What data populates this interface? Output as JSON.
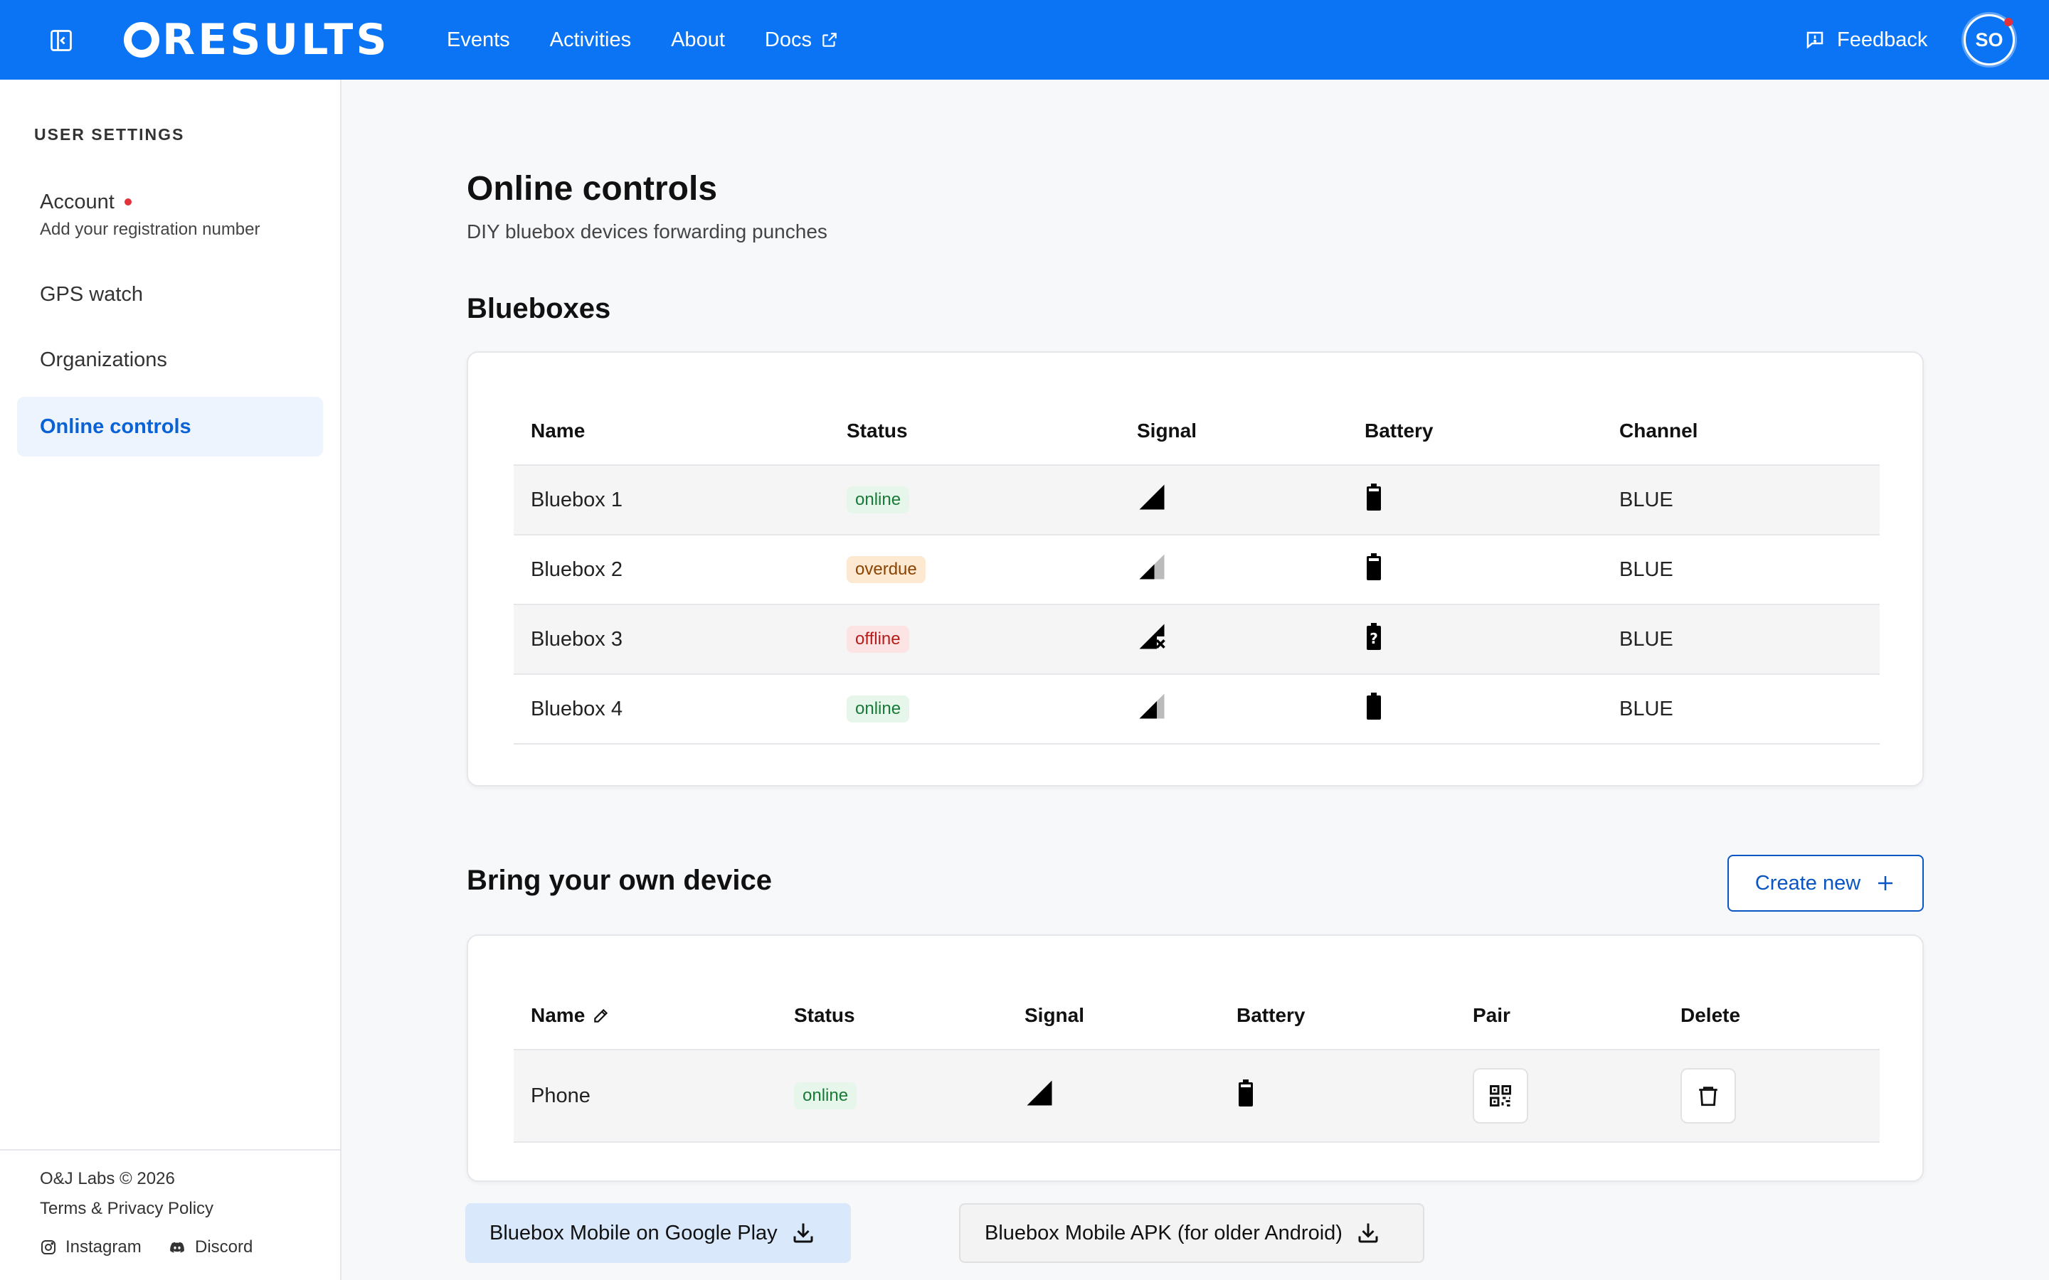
{
  "header": {
    "logo": "RESULTS",
    "nav": [
      "Events",
      "Activities",
      "About",
      "Docs"
    ],
    "feedback": "Feedback",
    "avatar": "SO"
  },
  "sidebar": {
    "heading": "USER SETTINGS",
    "items": [
      {
        "label": "Account",
        "sub": "Add your registration number"
      },
      {
        "label": "GPS watch"
      },
      {
        "label": "Organizations"
      },
      {
        "label": "Online controls"
      }
    ],
    "footer": {
      "copyright": "O&J Labs © 2026",
      "terms": "Terms & Privacy Policy",
      "instagram": "Instagram",
      "discord": "Discord"
    }
  },
  "main": {
    "title": "Online controls",
    "subtitle": "DIY bluebox devices forwarding punches",
    "blueboxes": {
      "title": "Blueboxes",
      "columns": [
        "Name",
        "Status",
        "Signal",
        "Battery",
        "Channel"
      ],
      "rows": [
        {
          "name": "Bluebox 1",
          "status": "online",
          "signal": "signal-full-icon",
          "battery": "battery-high-icon",
          "channel": "BLUE"
        },
        {
          "name": "Bluebox 2",
          "status": "overdue",
          "signal": "signal-medium-icon",
          "battery": "battery-high-icon",
          "channel": "BLUE"
        },
        {
          "name": "Bluebox 3",
          "status": "offline",
          "signal": "signal-none-icon",
          "battery": "battery-unknown-icon",
          "channel": "BLUE"
        },
        {
          "name": "Bluebox 4",
          "status": "online",
          "signal": "signal-medium-icon",
          "battery": "battery-full-icon",
          "channel": "BLUE"
        }
      ]
    },
    "byod": {
      "title": "Bring your own device",
      "create_label": "Create new",
      "columns": [
        "Name",
        "Status",
        "Signal",
        "Battery",
        "Pair",
        "Delete"
      ],
      "rows": [
        {
          "name": "Phone",
          "status": "online"
        }
      ]
    },
    "downloads": {
      "google_play": "Bluebox Mobile on Google Play",
      "apk": "Bluebox Mobile APK (for older Android)"
    }
  },
  "colors": {
    "brand": "#0a74f5",
    "online": "#187a37",
    "overdue": "#8a4300",
    "offline": "#b51c1c"
  }
}
